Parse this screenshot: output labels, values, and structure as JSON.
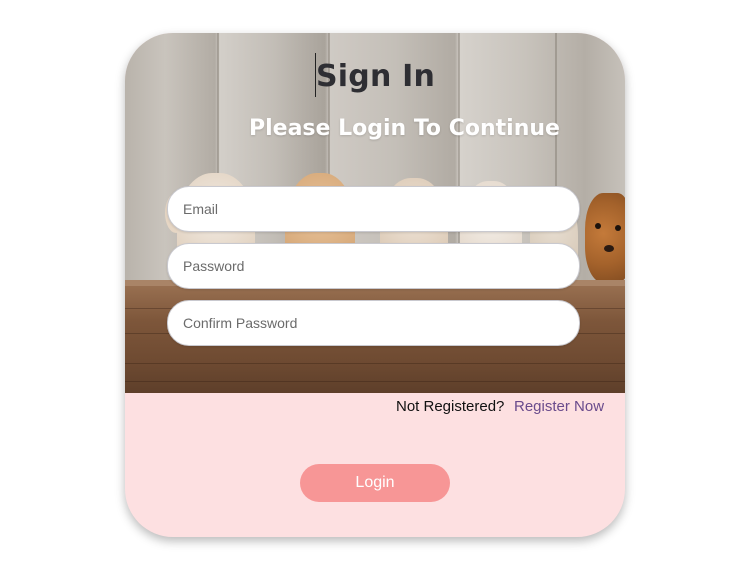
{
  "form": {
    "title": "Sign In",
    "subtitle": "Please Login To Continue",
    "email_placeholder": "Email",
    "password_placeholder": "Password",
    "confirm_placeholder": "Confirm Password",
    "not_registered_text": "Not Registered?",
    "register_link_label": "Register Now",
    "login_button_label": "Login"
  },
  "colors": {
    "card_background": "#fde0e1",
    "login_button": "#f79696",
    "register_link": "#6a4b8c",
    "title": "#2e2e33"
  },
  "background_image": {
    "subject": "puppies-peeking-over-wooden-table"
  }
}
